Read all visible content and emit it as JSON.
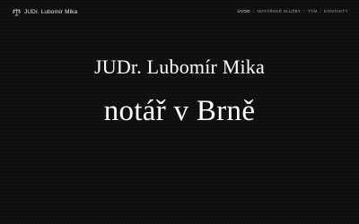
{
  "header": {
    "brand_icon": "scales-of-justice-icon",
    "brand_name": "JUDr. Lubomír Mika"
  },
  "nav": {
    "items": [
      {
        "label": "ÚVOD",
        "active": true
      },
      {
        "label": "NOTÁŘSKÉ SLUŽBY",
        "active": false
      },
      {
        "label": "TÝM",
        "active": false
      },
      {
        "label": "KONTAKTY",
        "active": false
      }
    ],
    "separator": "/"
  },
  "hero": {
    "name": "JUDr. Lubomír Mika",
    "role": "notář v Brně"
  },
  "colors": {
    "background": "#101010",
    "text": "#ffffff",
    "nav_text": "#a0a0a0",
    "nav_active": "#e6e6e6"
  }
}
